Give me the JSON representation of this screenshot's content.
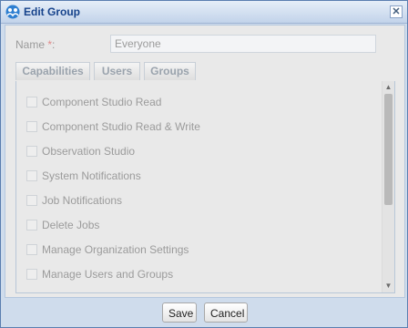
{
  "window": {
    "title": "Edit Group",
    "close_symbol": "✕",
    "icon": "group-app-icon"
  },
  "form": {
    "name_label": "Name",
    "required_mark": "*",
    "label_suffix": ":",
    "name_value": "Everyone"
  },
  "tabs": [
    {
      "label": "Capabilities",
      "active": true
    },
    {
      "label": "Users",
      "active": false
    },
    {
      "label": "Groups",
      "active": false
    }
  ],
  "capabilities": [
    {
      "label": "Component Studio Read",
      "checked": false
    },
    {
      "label": "Component Studio Read & Write",
      "checked": false
    },
    {
      "label": "Observation Studio",
      "checked": false
    },
    {
      "label": "System Notifications",
      "checked": false
    },
    {
      "label": "Job Notifications",
      "checked": false
    },
    {
      "label": "Delete Jobs",
      "checked": false
    },
    {
      "label": "Manage Organization Settings",
      "checked": false
    },
    {
      "label": "Manage Users and Groups",
      "checked": false
    }
  ],
  "scrollbar": {
    "up_symbol": "▲",
    "down_symbol": "▼"
  },
  "buttons": {
    "save": "Save",
    "cancel": "Cancel"
  },
  "colors": {
    "title_text": "#15428b",
    "frame_border": "#5b7fb0",
    "disabled_text": "#9b9b9b"
  }
}
